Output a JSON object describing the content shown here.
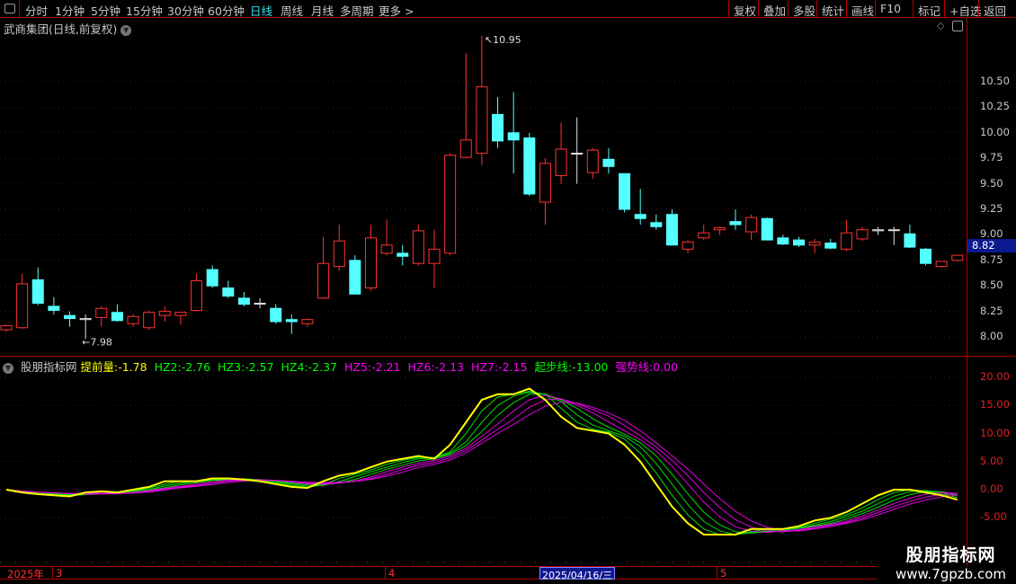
{
  "toolbar": {
    "timeframes": [
      "分时",
      "1分钟",
      "5分钟",
      "15分钟",
      "30分钟",
      "60分钟",
      "日线",
      "周线",
      "月线",
      "多周期",
      "更多 >"
    ],
    "active": "日线",
    "right_buttons": [
      "复权",
      "叠加",
      "多股",
      "统计",
      "画线",
      "F10",
      "标记",
      "+自选",
      "返回"
    ]
  },
  "main": {
    "title": "武商集团(日线,前复权)",
    "high_label": "10.95",
    "low_label": "7.98",
    "current_price": "8.82",
    "y_ticks": [
      "10.50",
      "10.25",
      "10.00",
      "9.75",
      "9.50",
      "9.25",
      "9.00",
      "8.75",
      "8.50",
      "8.25",
      "8.00"
    ],
    "y_tick_values": [
      10.5,
      10.25,
      10,
      9.75,
      9.5,
      9.25,
      9,
      8.75,
      8.5,
      8.25,
      8.0
    ],
    "candles": [
      [
        8.07,
        8.12,
        8.05,
        8.11
      ],
      [
        8.09,
        8.62,
        8.08,
        8.52
      ],
      [
        8.56,
        8.68,
        8.31,
        8.33
      ],
      [
        8.3,
        8.39,
        8.22,
        8.26
      ],
      [
        8.21,
        8.25,
        8.1,
        8.18
      ],
      [
        8.17,
        8.22,
        7.98,
        8.18
      ],
      [
        8.19,
        8.3,
        8.1,
        8.28
      ],
      [
        8.24,
        8.32,
        8.15,
        8.16
      ],
      [
        8.13,
        8.22,
        8.1,
        8.2
      ],
      [
        8.09,
        8.26,
        8.07,
        8.24
      ],
      [
        8.21,
        8.3,
        8.15,
        8.25
      ],
      [
        8.21,
        8.24,
        8.12,
        8.24
      ],
      [
        8.26,
        8.62,
        8.25,
        8.55
      ],
      [
        8.66,
        8.7,
        8.48,
        8.5
      ],
      [
        8.48,
        8.55,
        8.38,
        8.4
      ],
      [
        8.38,
        8.44,
        8.3,
        8.32
      ],
      [
        8.33,
        8.38,
        8.28,
        8.33
      ],
      [
        8.28,
        8.32,
        8.13,
        8.15
      ],
      [
        8.17,
        8.22,
        8.03,
        8.15
      ],
      [
        8.13,
        8.18,
        8.1,
        8.17
      ],
      [
        8.38,
        8.98,
        8.37,
        8.72
      ],
      [
        8.69,
        9.1,
        8.65,
        8.94
      ],
      [
        8.75,
        8.8,
        8.42,
        8.42
      ],
      [
        8.48,
        9.1,
        8.45,
        8.97
      ],
      [
        8.82,
        9.15,
        8.8,
        8.9
      ],
      [
        8.82,
        8.9,
        8.7,
        8.79
      ],
      [
        8.72,
        9.1,
        8.7,
        9.04
      ],
      [
        8.72,
        9.05,
        8.48,
        8.86
      ],
      [
        8.82,
        9.8,
        8.8,
        9.78
      ],
      [
        9.76,
        10.78,
        9.75,
        9.93
      ],
      [
        9.8,
        10.95,
        9.68,
        10.45
      ],
      [
        10.18,
        10.35,
        9.85,
        9.92
      ],
      [
        10.0,
        10.4,
        9.6,
        9.93
      ],
      [
        9.95,
        10.0,
        9.38,
        9.4
      ],
      [
        9.32,
        9.75,
        9.1,
        9.7
      ],
      [
        9.58,
        10.1,
        9.5,
        9.84
      ],
      [
        9.8,
        10.15,
        9.5,
        9.8
      ],
      [
        9.61,
        9.85,
        9.55,
        9.83
      ],
      [
        9.74,
        9.85,
        9.6,
        9.67
      ],
      [
        9.6,
        9.6,
        9.22,
        9.25
      ],
      [
        9.2,
        9.45,
        9.1,
        9.16
      ],
      [
        9.12,
        9.2,
        9.05,
        9.08
      ],
      [
        9.2,
        9.25,
        8.9,
        8.9
      ],
      [
        8.86,
        8.95,
        8.82,
        8.93
      ],
      [
        8.97,
        9.1,
        8.95,
        9.02
      ],
      [
        9.05,
        9.08,
        9.0,
        9.07
      ],
      [
        9.13,
        9.25,
        9.05,
        9.1
      ],
      [
        9.03,
        9.2,
        8.95,
        9.17
      ],
      [
        9.16,
        9.17,
        8.95,
        8.95
      ],
      [
        8.97,
        9.0,
        8.9,
        8.91
      ],
      [
        8.95,
        8.98,
        8.88,
        8.9
      ],
      [
        8.9,
        8.96,
        8.82,
        8.93
      ],
      [
        8.92,
        8.96,
        8.86,
        8.87
      ],
      [
        8.86,
        9.15,
        8.84,
        9.02
      ],
      [
        8.96,
        9.08,
        8.94,
        9.05
      ],
      [
        9.04,
        9.08,
        9.0,
        9.05
      ],
      [
        9.05,
        9.08,
        8.9,
        9.05
      ],
      [
        9.01,
        9.1,
        8.87,
        8.88
      ],
      [
        8.86,
        8.87,
        8.7,
        8.72
      ],
      [
        8.69,
        8.74,
        8.68,
        8.74
      ],
      [
        8.75,
        8.8,
        8.74,
        8.8
      ]
    ]
  },
  "indicator": {
    "name": "股朋指标网",
    "legend": [
      {
        "label": "提前量:",
        "value": "-1.78",
        "color": "#ffff00"
      },
      {
        "label": "HZ2:",
        "value": "-2.76",
        "color": "#00ff00"
      },
      {
        "label": "HZ3:",
        "value": "-2.57",
        "color": "#00ff00"
      },
      {
        "label": "HZ4:",
        "value": "-2.37",
        "color": "#00ff00"
      },
      {
        "label": "HZ5:",
        "value": "-2.21",
        "color": "#ff00ff"
      },
      {
        "label": "HZ6:",
        "value": "-2.13",
        "color": "#ff00ff"
      },
      {
        "label": "HZ7:",
        "value": "-2.15",
        "color": "#ff00ff"
      },
      {
        "label": "起步线:",
        "value": "-13.00",
        "color": "#00ff00"
      },
      {
        "label": "强势线:",
        "value": "0.00",
        "color": "#ff00ff"
      }
    ],
    "y_ticks": [
      "20.00",
      "15.00",
      "10.00",
      "5.00",
      "0.00",
      "-5.00"
    ],
    "y_tick_values": [
      20,
      15,
      10,
      5,
      0,
      -5
    ],
    "lead": [
      0,
      -0.5,
      -0.8,
      -1,
      -1.2,
      -0.5,
      -0.3,
      -0.5,
      0,
      0.5,
      1.5,
      1.5,
      1.5,
      2,
      2,
      1.8,
      1.5,
      1,
      0.5,
      0.3,
      1.5,
      2.5,
      3,
      4,
      5,
      5.5,
      6,
      5.5,
      8,
      12,
      16,
      17,
      17,
      18,
      16,
      13,
      11,
      10.5,
      10,
      8,
      5,
      1,
      -3,
      -6,
      -8,
      -8,
      -8,
      -7,
      -7,
      -7,
      -6.5,
      -5.5,
      -5,
      -4,
      -2.5,
      -1,
      0,
      0,
      -0.5,
      -1,
      -1.78
    ]
  },
  "date_bar": {
    "year": "2025年",
    "months": [
      "3",
      "4",
      "5"
    ],
    "selected": "2025/04/16/三"
  },
  "watermark": {
    "line1": "股朋指标网",
    "line2": "www.7gpzb.com"
  },
  "colors": {
    "up": "#ff3232",
    "down": "#54ffff",
    "lead": "#ffff00",
    "green": "#00e000",
    "magenta": "#e000e0"
  }
}
